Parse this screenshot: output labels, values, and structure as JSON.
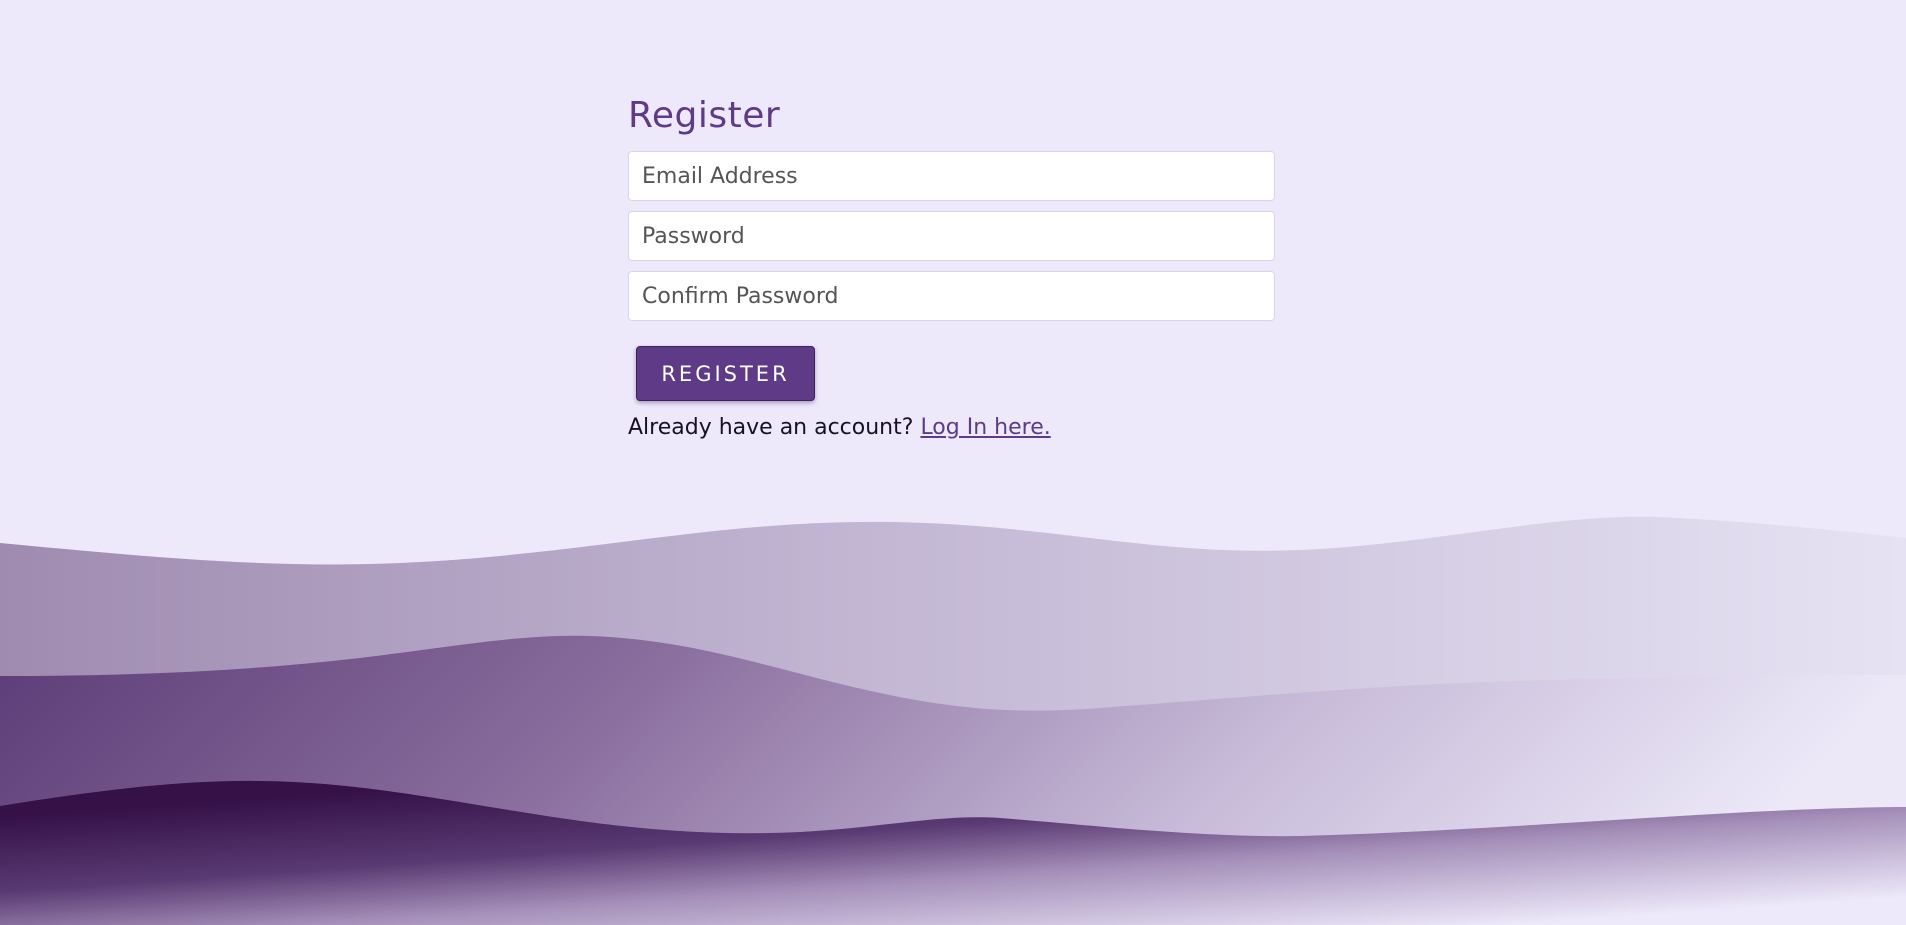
{
  "form": {
    "title": "Register",
    "email_placeholder": "Email Address",
    "password_placeholder": "Password",
    "confirm_placeholder": "Confirm Password",
    "submit_label": "REGISTER",
    "login_prompt": "Already have an account?",
    "login_link": "Log In here."
  },
  "colors": {
    "background": "#ede9fa",
    "accent": "#5e3a87",
    "deep_purple": "#351148"
  }
}
